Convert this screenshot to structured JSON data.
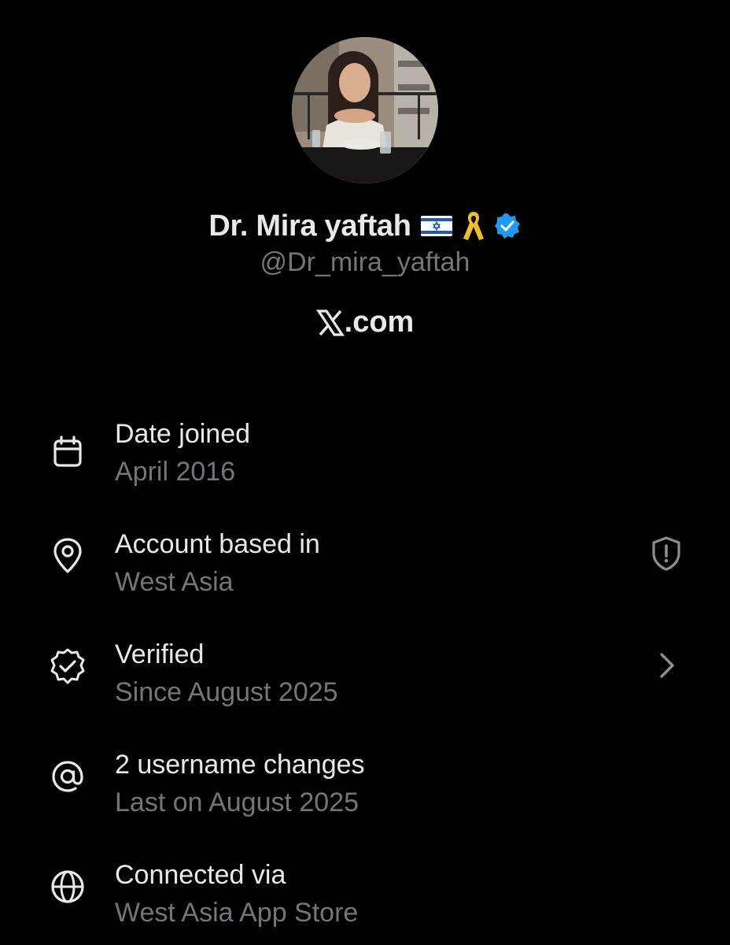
{
  "profile": {
    "display_name": "Dr. Mira yaftah",
    "handle": "@Dr_mira_yaftah",
    "site_suffix": ".com",
    "badges": [
      "israel-flag-icon",
      "yellow-ribbon-icon",
      "verified-badge-icon"
    ]
  },
  "about": {
    "items": [
      {
        "icon": "calendar-icon",
        "title": "Date joined",
        "subtitle": "April 2016"
      },
      {
        "icon": "location-pin-icon",
        "title": "Account based in",
        "subtitle": "West Asia",
        "trailing_icon": "shield-alert-icon"
      },
      {
        "icon": "verified-seal-icon",
        "title": "Verified",
        "subtitle": "Since August 2025",
        "trailing_icon": "chevron-right-icon"
      },
      {
        "icon": "at-sign-icon",
        "title": "2 username changes",
        "subtitle": "Last on August 2025"
      },
      {
        "icon": "globe-icon",
        "title": "Connected via",
        "subtitle": "West Asia App Store"
      }
    ]
  },
  "colors": {
    "background": "#000000",
    "primary_text": "#e7e9ea",
    "secondary_text": "#71767b",
    "verified_blue": "#1d9bf0",
    "ribbon_yellow": "#f2c21b"
  }
}
